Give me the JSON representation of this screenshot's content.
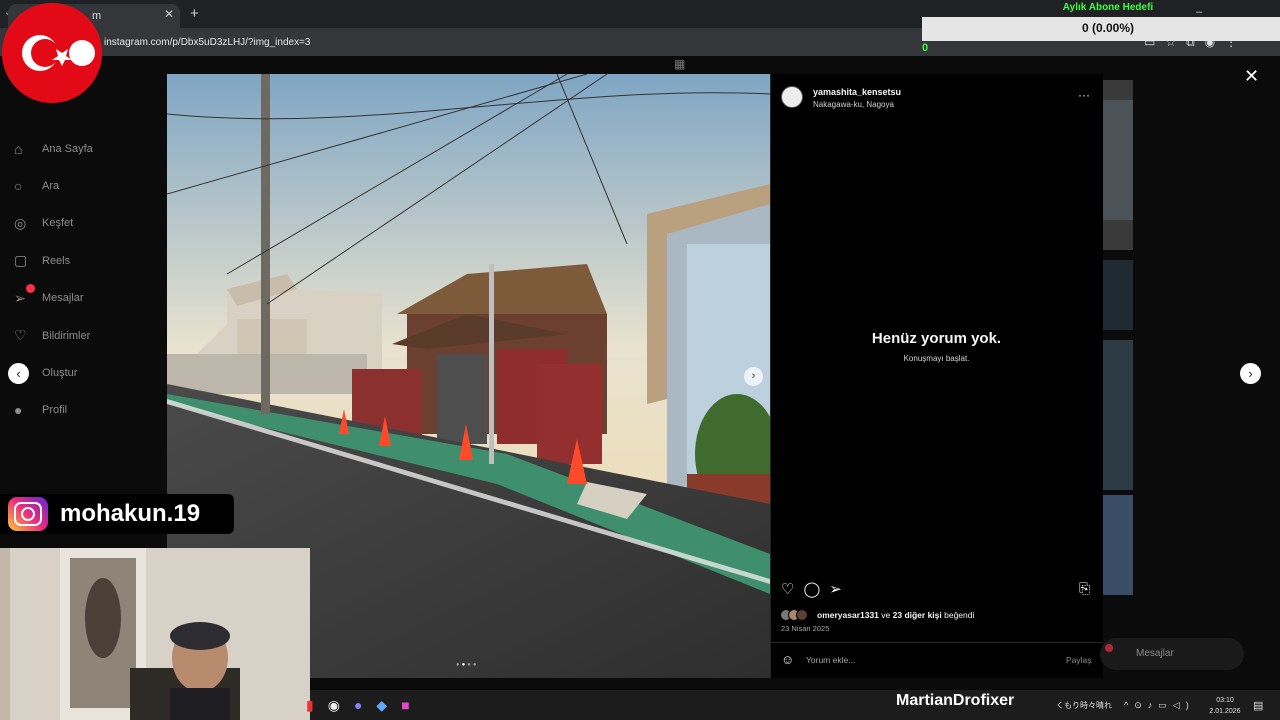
{
  "browser": {
    "tab_title": "m",
    "url": "instagram.com/p/Dbx5uD3zLHJ/?img_index=3",
    "tab_close": "✕",
    "new_tab": "+"
  },
  "sidebar": {
    "items": [
      {
        "label": "Ana Sayfa",
        "icon": "home-icon"
      },
      {
        "label": "Ara",
        "icon": "search-icon"
      },
      {
        "label": "Keşfet",
        "icon": "explore-icon"
      },
      {
        "label": "Reels",
        "icon": "reels-icon"
      },
      {
        "label": "Mesajlar",
        "icon": "messages-icon"
      },
      {
        "label": "Bildirimler",
        "icon": "heart-icon"
      },
      {
        "label": "Oluştur",
        "icon": "create-icon"
      },
      {
        "label": "Profil",
        "icon": "profile-icon"
      }
    ]
  },
  "post": {
    "username": "yamashita_kensetsu",
    "location": "Nakagawa-ku, Nagoya",
    "no_comments_title": "Henüz yorum yok.",
    "no_comments_sub": "Konuşmayı başlat.",
    "liker_name": "omeryasar1331",
    "likes_mid": " ve ",
    "likes_others": "23 diğer kişi",
    "likes_suffix": " beğendi",
    "date": "23 Nisan 2025",
    "comment_placeholder": "Yorum ekle...",
    "post_button": "Paylaş",
    "carousel_count": 4,
    "carousel_active": 1
  },
  "floating_messages": {
    "label": "Mesajlar"
  },
  "overlay": {
    "goal_title": "Aylık Abone Hedefi",
    "goal_value": "0 (0.00%)",
    "goal_count": "0",
    "social_handle": "mohakun.19"
  },
  "taskbar": {
    "streamer_text": "MartianDrofixer",
    "jp_text": "くもり時々晴れ",
    "time": "03:10",
    "date": "2.01.2026"
  },
  "colors": {
    "goal_green": "#3cff3c",
    "instagram_bg": "#000000",
    "turkish_red": "#e30a17"
  }
}
